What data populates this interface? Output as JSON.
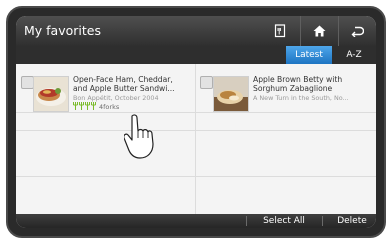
{
  "header": {
    "title": "My favorites",
    "icons": [
      "cookbook-icon",
      "home-icon",
      "back-icon"
    ]
  },
  "tabs": [
    {
      "label": "Latest",
      "selected": true
    },
    {
      "label": "A-Z",
      "selected": false
    }
  ],
  "recipes": [
    {
      "title_line1": "Open-Face Ham, Cheddar,",
      "title_line2": "and Apple Butter Sandwi...",
      "source": "Bon Appétit, October 2004",
      "rating": "4forks",
      "forks_count": 4
    },
    {
      "title_line1": "Apple Brown Betty with",
      "title_line2": "Sorghum Zabaglione",
      "source": "A New Turn in the South, No..."
    }
  ],
  "bottom_bar": {
    "select_all": "Select All",
    "delete": "Delete"
  },
  "colors": {
    "accent": "#2a86d6",
    "header_bg": "#3a3a3a"
  }
}
